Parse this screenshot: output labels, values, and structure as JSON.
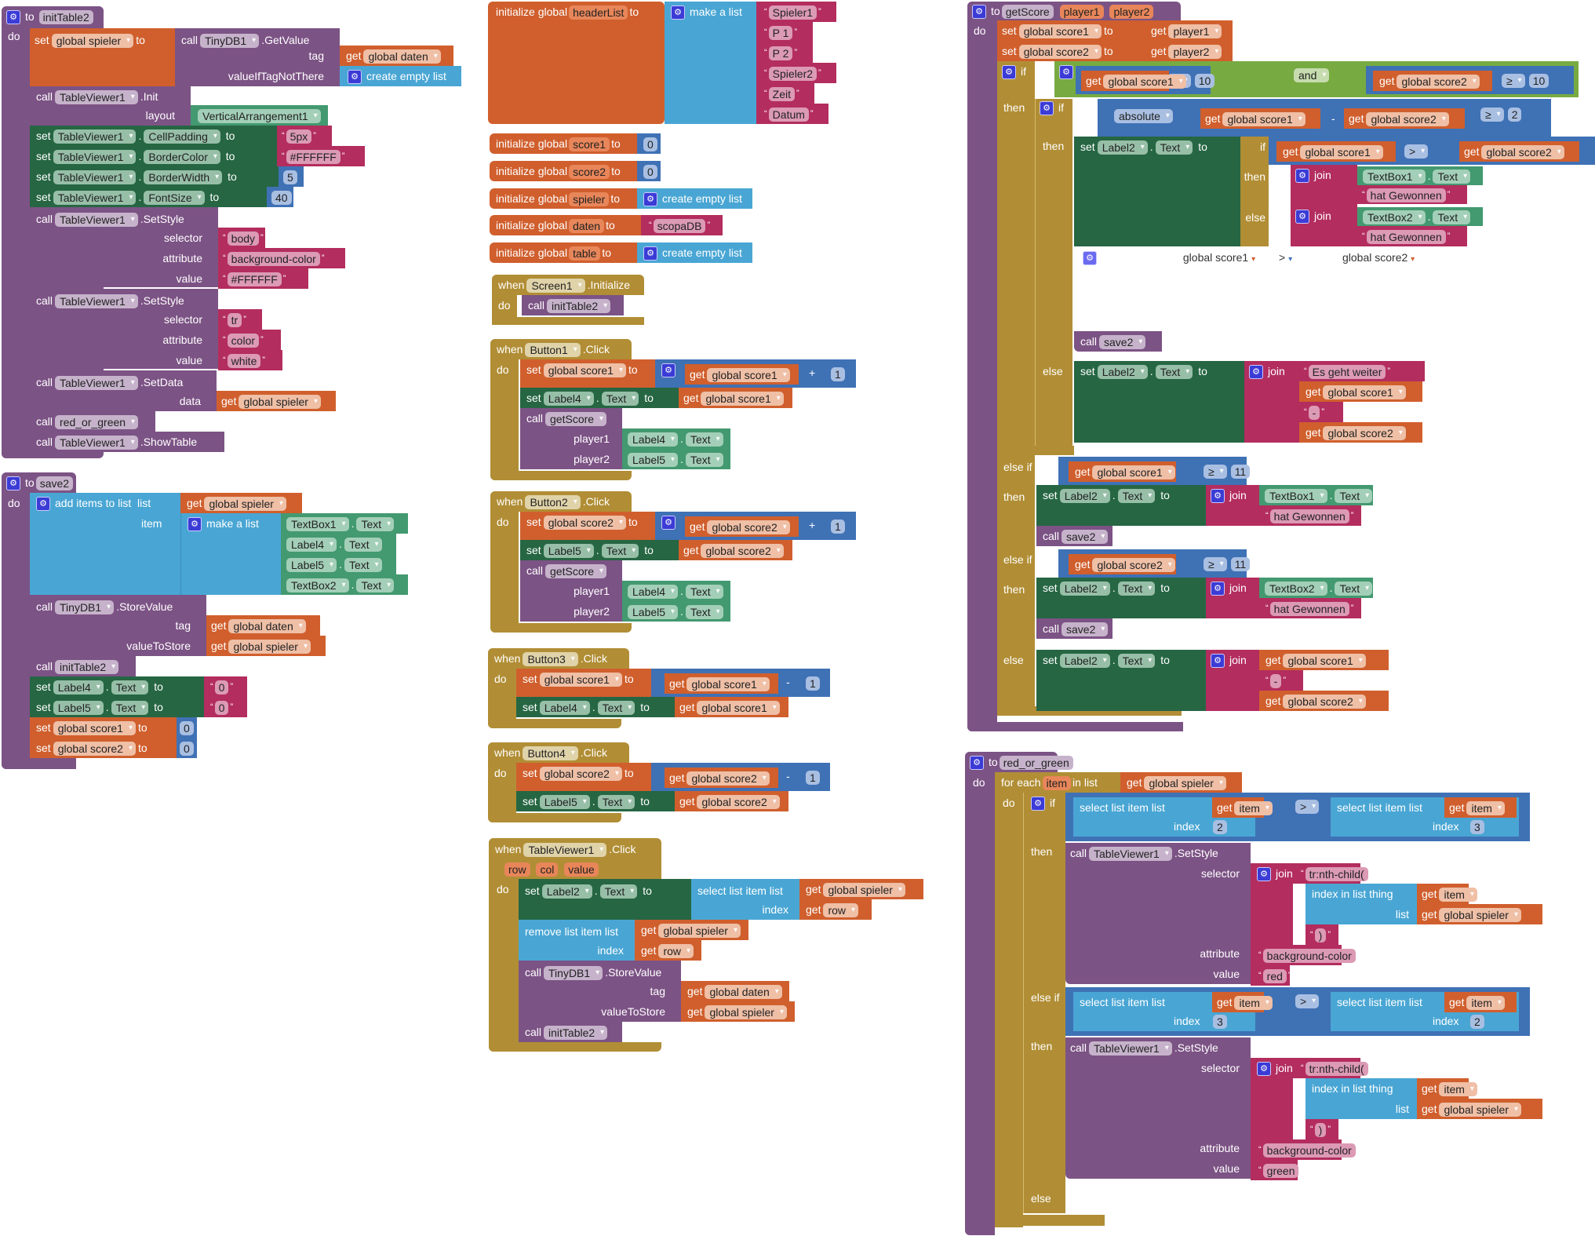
{
  "workspace": "App Inventor Blocks Editor",
  "blocks": {
    "initTable2": {
      "header": "to",
      "name": "initTable2",
      "do": "do",
      "set_spieler": {
        "set": "set",
        "var": "global spieler",
        "to": "to",
        "call": "call",
        "component": "TinyDB1",
        "method": ".GetValue",
        "tag_label": "tag",
        "tag_get": "get",
        "tag_var": "global daten",
        "vitnt_label": "valueIfTagNotThere",
        "empty_list": "create empty list"
      },
      "init": {
        "call": "call",
        "component": "TableViewer1",
        "method": ".Init",
        "layout_label": "layout",
        "layout_value": "VerticalArrangement1"
      },
      "props": [
        {
          "set": "set",
          "component": "TableViewer1",
          "prop": "CellPadding",
          "to": "to",
          "value": "5px",
          "kind": "text"
        },
        {
          "set": "set",
          "component": "TableViewer1",
          "prop": "BorderColor",
          "to": "to",
          "value": "#FFFFFF",
          "kind": "text"
        },
        {
          "set": "set",
          "component": "TableViewer1",
          "prop": "BorderWidth",
          "to": "to",
          "value": "5",
          "kind": "number"
        },
        {
          "set": "set",
          "component": "TableViewer1",
          "prop": "FontSize",
          "to": "to",
          "value": "40",
          "kind": "number"
        }
      ],
      "style1": {
        "call": "call",
        "component": "TableViewer1",
        "method": ".SetStyle",
        "selector_label": "selector",
        "selector": "body",
        "attribute_label": "attribute",
        "attribute": "background-color",
        "value_label": "value",
        "value": "#FFFFFF"
      },
      "style2": {
        "call": "call",
        "component": "TableViewer1",
        "method": ".SetStyle",
        "selector_label": "selector",
        "selector": "tr",
        "attribute_label": "attribute",
        "attribute": "color",
        "value_label": "value",
        "value": "white"
      },
      "setdata": {
        "call": "call",
        "component": "TableViewer1",
        "method": ".SetData",
        "data_label": "data",
        "get": "get",
        "var": "global spieler"
      },
      "call_rog": {
        "call": "call",
        "proc": "red_or_green"
      },
      "show": {
        "call": "call",
        "component": "TableViewer1",
        "method": ".ShowTable"
      }
    },
    "save2": {
      "header": "to",
      "name": "save2",
      "do": "do",
      "add": {
        "label": "add items to list",
        "list_label": "list",
        "get": "get",
        "var": "global spieler",
        "item_label": "item",
        "make_list": "make a list",
        "items": [
          {
            "component": "TextBox1",
            "prop": "Text"
          },
          {
            "component": "Label4",
            "prop": "Text"
          },
          {
            "component": "Label5",
            "prop": "Text"
          },
          {
            "component": "TextBox2",
            "prop": "Text"
          }
        ]
      },
      "store": {
        "call": "call",
        "component": "TinyDB1",
        "method": ".StoreValue",
        "tag_label": "tag",
        "tag_var": "global daten",
        "vts_label": "valueToStore",
        "vts_var": "global spieler",
        "get": "get"
      },
      "call_init": {
        "call": "call",
        "proc": "initTable2"
      },
      "resets": [
        {
          "set": "set",
          "component": "Label4",
          "prop": "Text",
          "to": "to",
          "value": "0"
        },
        {
          "set": "set",
          "component": "Label5",
          "prop": "Text",
          "to": "to",
          "value": "0"
        }
      ],
      "var_resets": [
        {
          "set": "set",
          "var": "global score1",
          "to": "to",
          "value": "0"
        },
        {
          "set": "set",
          "var": "global score2",
          "to": "to",
          "value": "0"
        }
      ]
    },
    "globals": {
      "headerList": {
        "label": "initialize global",
        "name": "headerList",
        "to": "to",
        "make_list": "make a list",
        "items": [
          "Spieler1",
          "P 1",
          "P 2",
          "Spieler2",
          "Zeit",
          "Datum"
        ]
      },
      "others": [
        {
          "label": "initialize global",
          "name": "score1",
          "to": "to",
          "value": "0",
          "kind": "number"
        },
        {
          "label": "initialize global",
          "name": "score2",
          "to": "to",
          "value": "0",
          "kind": "number"
        },
        {
          "label": "initialize global",
          "name": "spieler",
          "to": "to",
          "value": "create empty list",
          "kind": "list"
        },
        {
          "label": "initialize global",
          "name": "daten",
          "to": "to",
          "value": "scopaDB",
          "kind": "text"
        },
        {
          "label": "initialize global",
          "name": "table",
          "to": "to",
          "value": "create empty list",
          "kind": "list"
        }
      ]
    },
    "screen_init": {
      "when": "when",
      "component": "Screen1",
      "event": ".Initialize",
      "do": "do",
      "call": "call",
      "proc": "initTable2"
    },
    "button1": {
      "when": "when",
      "component": "Button1",
      "event": ".Click",
      "do": "do",
      "set": "set",
      "var": "global score1",
      "to": "to",
      "get": "get",
      "op": "+",
      "num": "1",
      "label": "Label4",
      "prop": "Text",
      "call": "call",
      "proc": "getScore",
      "p1_label": "player1",
      "p1": "Label4",
      "p2_label": "player2",
      "p2": "Label5"
    },
    "button2": {
      "when": "when",
      "component": "Button2",
      "event": ".Click",
      "do": "do",
      "set": "set",
      "var": "global score2",
      "to": "to",
      "get": "get",
      "op": "+",
      "num": "1",
      "label": "Label5",
      "prop": "Text",
      "call": "call",
      "proc": "getScore",
      "p1_label": "player1",
      "p1": "Label4",
      "p2_label": "player2",
      "p2": "Label5"
    },
    "button3": {
      "when": "when",
      "component": "Button3",
      "event": ".Click",
      "do": "do",
      "set": "set",
      "var": "global score1",
      "to": "to",
      "get": "get",
      "op": "-",
      "num": "1",
      "label": "Label4",
      "prop": "Text"
    },
    "button4": {
      "when": "when",
      "component": "Button4",
      "event": ".Click",
      "do": "do",
      "set": "set",
      "var": "global score2",
      "to": "to",
      "get": "get",
      "op": "-",
      "num": "1",
      "label": "Label5",
      "prop": "Text"
    },
    "tv_click": {
      "when": "when",
      "component": "TableViewer1",
      "event": ".Click",
      "params": [
        "row",
        "col",
        "value"
      ],
      "do": "do",
      "set": "set",
      "label": "Label2",
      "prop": "Text",
      "to": "to",
      "select": "select list item  list",
      "get": "get",
      "var": "global spieler",
      "index_label": "index",
      "index_var": "row",
      "remove": "remove list item  list",
      "call": "call",
      "db": "TinyDB1",
      "store": ".StoreValue",
      "tag_label": "tag",
      "tag_var": "global daten",
      "vts_label": "valueToStore",
      "vts_var": "global spieler",
      "proc": "initTable2"
    },
    "getScore": {
      "header": "to",
      "name": "getScore",
      "params": [
        "player1",
        "player2"
      ],
      "do": "do",
      "set": "set",
      "to": "to",
      "get": "get",
      "if": "if",
      "then": "then",
      "else": "else",
      "else_if": "else if",
      "and": "and",
      "ge": "≥",
      "gt": ">",
      "minus": "-",
      "absolute": "absolute",
      "v1": "global score1",
      "v2": "global score2",
      "ten": "10",
      "two": "2",
      "eleven": "11",
      "label2": "Label2",
      "text": "Text",
      "join": "join",
      "tb1": "TextBox1",
      "tb2": "TextBox2",
      "won": "hat Gewonnen",
      "cont": "Es geht weiter",
      "dash": "-",
      "call": "call",
      "save": "save2"
    },
    "red_or_green": {
      "header": "to",
      "name": "red_or_green",
      "do": "do",
      "for_each": "for each",
      "item": "item",
      "in_list": "in list",
      "get": "get",
      "var": "global spieler",
      "if": "if",
      "then": "then",
      "else_if": "else if",
      "else": "else",
      "select": "select list item  list",
      "index_label": "index",
      "gt": ">",
      "call": "call",
      "component": "TableViewer1",
      "method": ".SetStyle",
      "selector_label": "selector",
      "join": "join",
      "nth": "tr:nth-child(",
      "index_in": "index in list  thing",
      "list_label": "list",
      "close": ")",
      "attribute_label": "attribute",
      "attribute": "background-color",
      "value_label": "value",
      "red": "red",
      "green": "green",
      "i2": "2",
      "i3": "3"
    }
  }
}
